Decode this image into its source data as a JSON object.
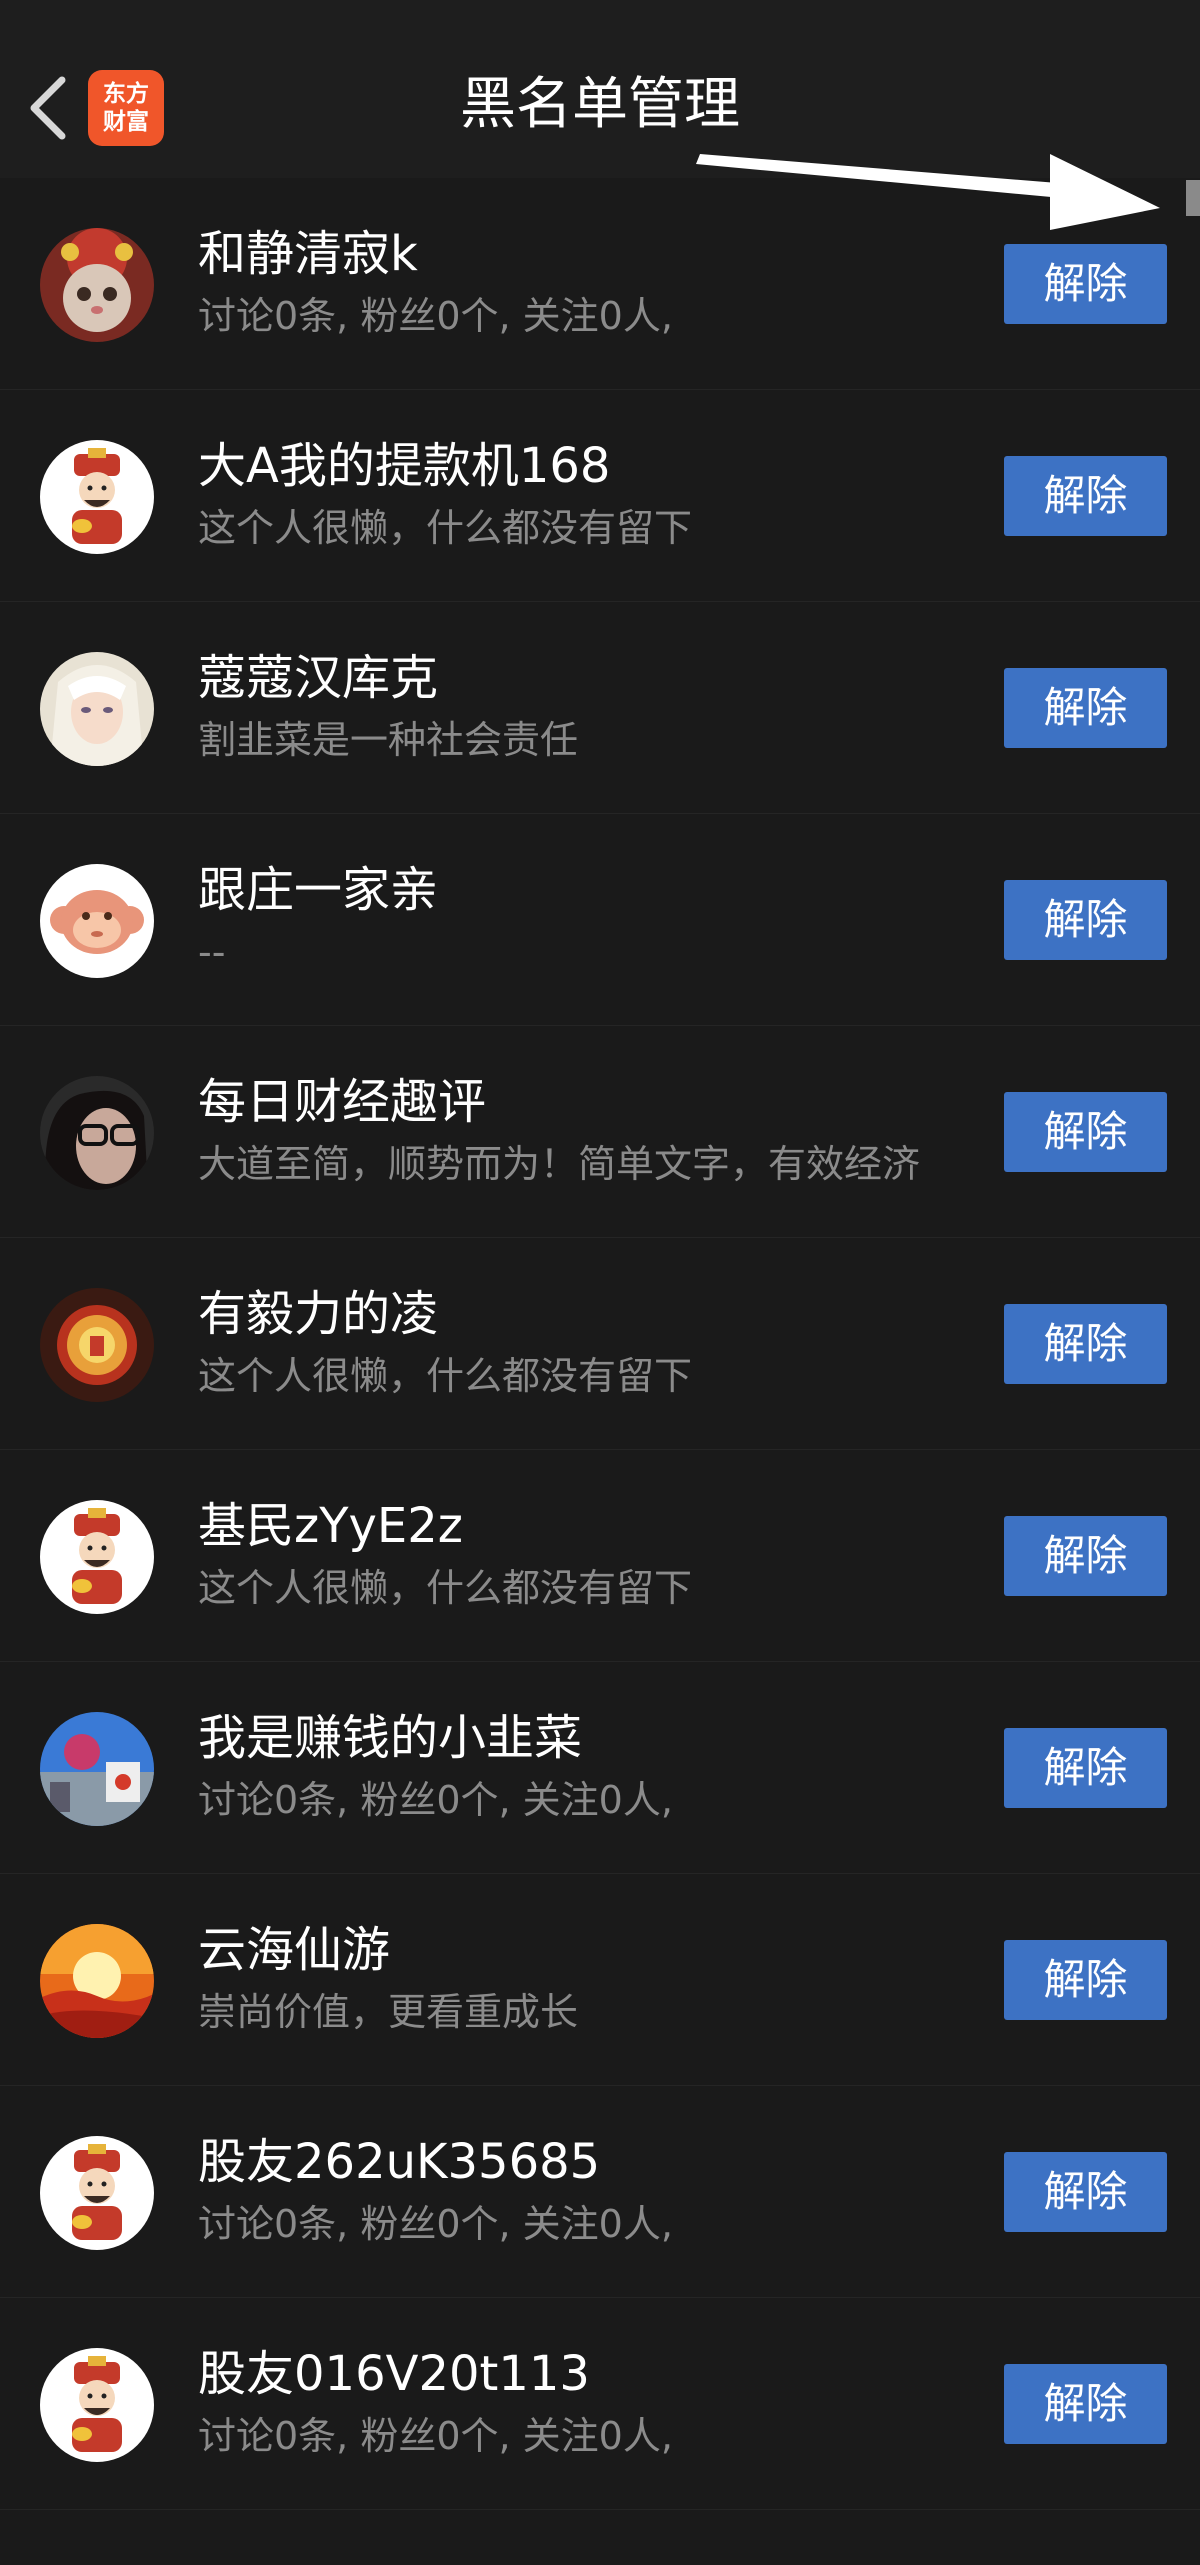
{
  "header": {
    "title": "黑名单管理",
    "logo_line1": "东方",
    "logo_line2": "财富"
  },
  "colors": {
    "background": "#1a1a1a",
    "button": "#3d72c4",
    "logo": "#f0562a"
  },
  "rows": [
    {
      "name": "和静清寂k",
      "desc": "讨论0条, 粉丝0个, 关注0人,",
      "button": "解除",
      "avatar": "cat-lion-dance-avatar"
    },
    {
      "name": "大A我的提款机168",
      "desc": "这个人很懒，什么都没有留下",
      "button": "解除",
      "avatar": "fortune-god-avatar"
    },
    {
      "name": "蔻蔻汉库克",
      "desc": "割韭菜是一种社会责任",
      "button": "解除",
      "avatar": "anime-girl-avatar"
    },
    {
      "name": "跟庄一家亲",
      "desc": "--",
      "button": "解除",
      "avatar": "monkey-avatar"
    },
    {
      "name": "每日财经趣评",
      "desc": "大道至简，顺势而为！简单文字，有效经济",
      "button": "解除",
      "avatar": "glasses-woman-avatar"
    },
    {
      "name": "有毅力的凌",
      "desc": "这个人很懒，什么都没有留下",
      "button": "解除",
      "avatar": "lantern-avatar"
    },
    {
      "name": "基民zYyE2z",
      "desc": "这个人很懒，什么都没有留下",
      "button": "解除",
      "avatar": "fortune-god-avatar"
    },
    {
      "name": "我是赚钱的小韭菜",
      "desc": "讨论0条, 粉丝0个, 关注0人,",
      "button": "解除",
      "avatar": "street-scene-avatar"
    },
    {
      "name": "云海仙游",
      "desc": "崇尚价值，更看重成长",
      "button": "解除",
      "avatar": "sunset-avatar"
    },
    {
      "name": "股友262uK35685",
      "desc": "讨论0条, 粉丝0个, 关注0人,",
      "button": "解除",
      "avatar": "fortune-god-avatar"
    },
    {
      "name": "股友016V20t113",
      "desc": "讨论0条, 粉丝0个, 关注0人,",
      "button": "解除",
      "avatar": "fortune-god-avatar"
    }
  ]
}
